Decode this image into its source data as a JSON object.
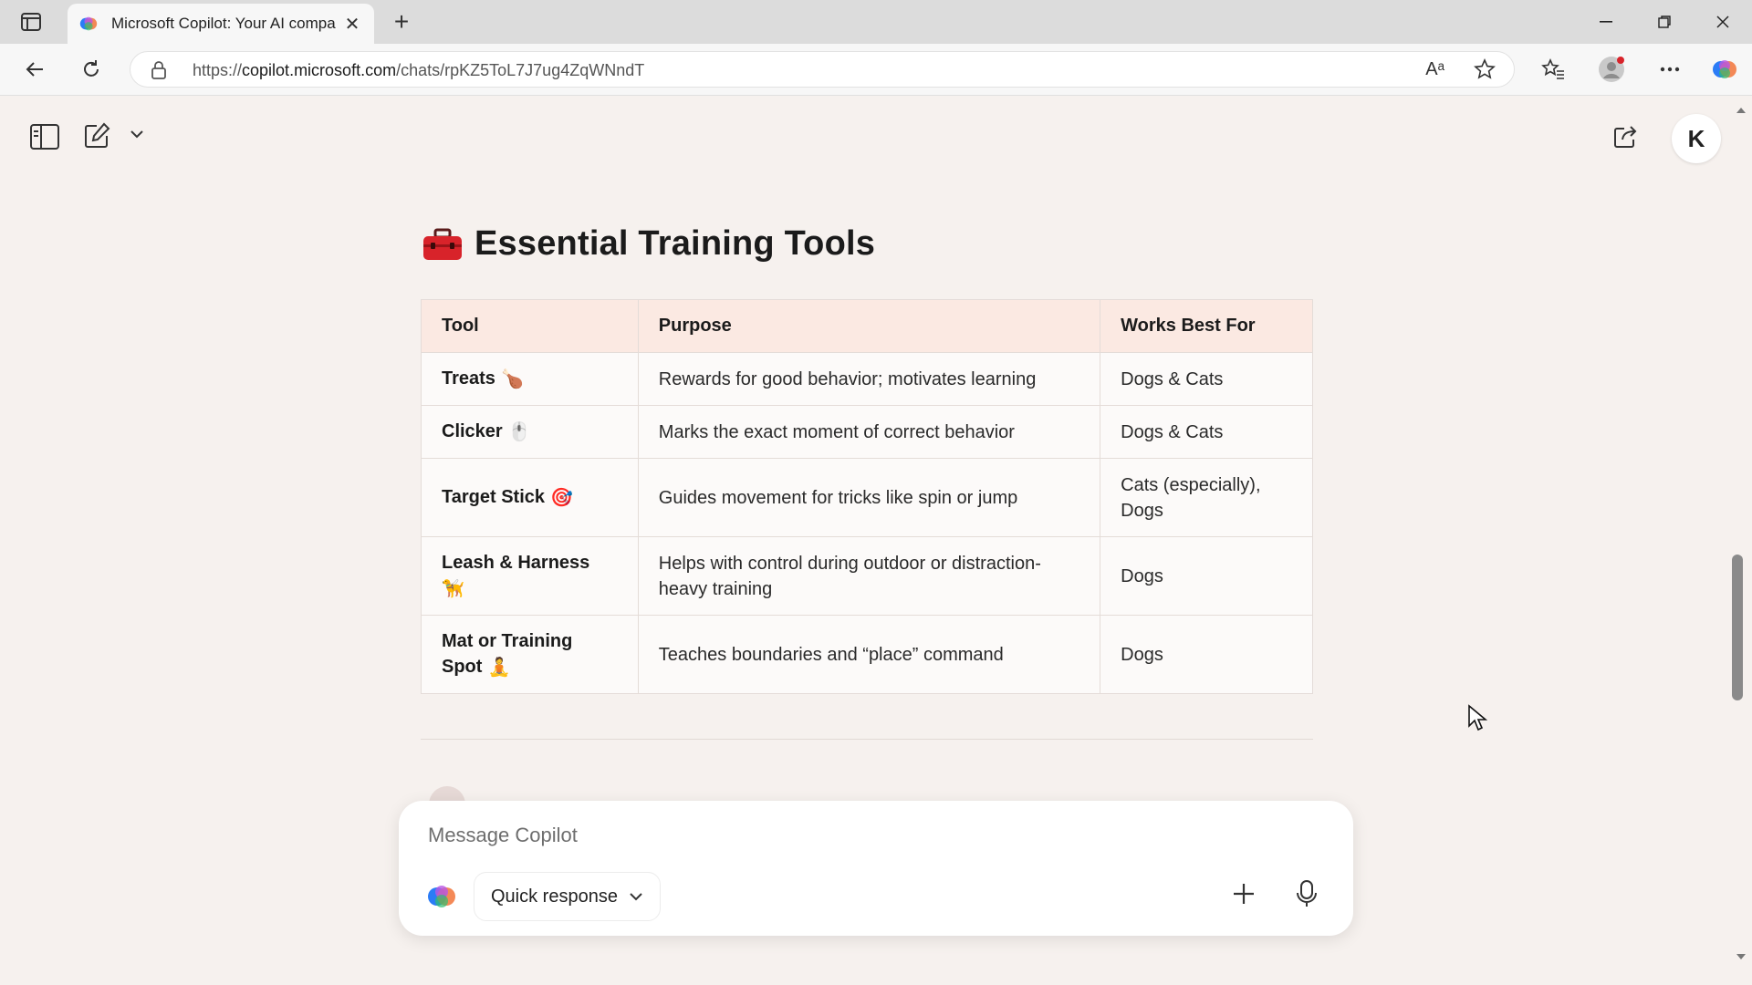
{
  "browser": {
    "tab_title": "Microsoft Copilot: Your AI compa",
    "url_prefix": "https://",
    "url_host": "copilot.microsoft.com",
    "url_path": "/chats/rpKZ5ToL7J7ug4ZqWNndT",
    "read_aloud_label": "Aᵃ",
    "newtab_glyph": "+",
    "close_glyph": "✕"
  },
  "app": {
    "avatar_initial": "K"
  },
  "content": {
    "heading": "Essential Training Tools",
    "table": {
      "headers": [
        "Tool",
        "Purpose",
        "Works Best For"
      ],
      "rows": [
        {
          "tool": "Treats",
          "emoji": "🍗",
          "purpose": "Rewards for good behavior; motivates learning",
          "best_for": "Dogs & Cats"
        },
        {
          "tool": "Clicker",
          "emoji": "🖱️",
          "purpose": "Marks the exact moment of correct behavior",
          "best_for": "Dogs & Cats"
        },
        {
          "tool": "Target Stick",
          "emoji": "🎯",
          "purpose": "Guides movement for tricks like spin or jump",
          "best_for": "Cats (especially), Dogs"
        },
        {
          "tool": "Leash & Harness",
          "emoji": "🦮",
          "purpose": "Helps with control during outdoor or distraction-heavy training",
          "best_for": "Dogs"
        },
        {
          "tool": "Mat or Training Spot",
          "emoji": "🧘",
          "purpose": "Teaches boundaries and “place” command",
          "best_for": "Dogs"
        }
      ]
    }
  },
  "composer": {
    "placeholder": "Message Copilot",
    "mode_label": "Quick response"
  },
  "colors": {
    "page_bg": "#f6f1ee",
    "table_header_bg": "#fbe9e2",
    "accent": "#d8232a"
  }
}
